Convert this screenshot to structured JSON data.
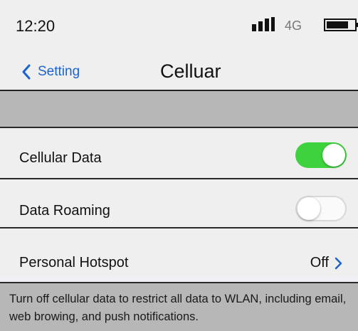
{
  "status_bar": {
    "time": "12:20",
    "network_type": "4G",
    "signal_icon": "signal-bars-icon",
    "battery_icon": "battery-icon"
  },
  "nav": {
    "back_label": "Setting",
    "back_icon": "chevron-left-icon",
    "title": "Celluar"
  },
  "settings": {
    "cellular_data": {
      "label": "Cellular Data",
      "enabled": true
    },
    "data_roaming": {
      "label": "Data Roaming",
      "enabled": false
    },
    "personal_hotspot": {
      "label": "Personal Hotspot",
      "value": "Off",
      "chevron_icon": "chevron-right-icon"
    }
  },
  "footer": {
    "note": "Turn off cellular data to restrict all data to WLAN, including email, web browing, and push notifications."
  },
  "colors": {
    "accent": "#1a63d1",
    "toggle_on": "#3fd23f",
    "background": "#efefef",
    "section_gray": "#b7b7b7"
  }
}
